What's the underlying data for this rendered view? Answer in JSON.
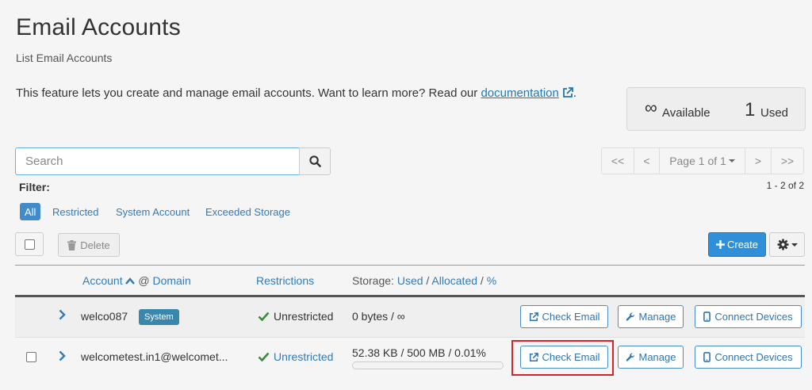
{
  "header": {
    "title": "Email Accounts",
    "subtitle": "List Email Accounts",
    "intro_text": "This feature lets you create and manage email accounts. Want to learn more? Read our",
    "doc_link": "documentation",
    "intro_end": "."
  },
  "stats": {
    "available_symbol": "∞",
    "available_label": "Available",
    "used_count": "1",
    "used_label": "Used"
  },
  "search": {
    "placeholder": "Search"
  },
  "pagination": {
    "first": "<<",
    "prev": "<",
    "page_label": "Page 1 of 1",
    "next": ">",
    "last": ">>",
    "count": "1 - 2 of 2"
  },
  "filter": {
    "label": "Filter:",
    "options": [
      "All",
      "Restricted",
      "System Account",
      "Exceeded Storage"
    ]
  },
  "toolbar": {
    "delete_label": "Delete",
    "create_label": "Create"
  },
  "table": {
    "headers": {
      "account": "Account",
      "at_sep": "@",
      "domain": "Domain",
      "restrictions": "Restrictions",
      "storage_prefix": "Storage:",
      "used": "Used",
      "slash": "/",
      "allocated": "Allocated",
      "percent": "%"
    },
    "rows": [
      {
        "account": "welco087",
        "badge": "System",
        "restriction": "Unrestricted",
        "storage": "0 bytes / ∞",
        "check_email": "Check Email",
        "manage": "Manage",
        "connect": "Connect Devices"
      },
      {
        "account": "welcometest.in1@welcomet...",
        "restriction": "Unrestricted",
        "storage": "52.38 KB / 500 MB / 0.01%",
        "storage_percent": 0.01,
        "check_email": "Check Email",
        "manage": "Manage",
        "connect": "Connect Devices"
      }
    ]
  },
  "colors": {
    "accent": "#2f8fd9",
    "link": "#337ab7",
    "success": "#3c8a3c",
    "highlight": "#d9232a"
  }
}
